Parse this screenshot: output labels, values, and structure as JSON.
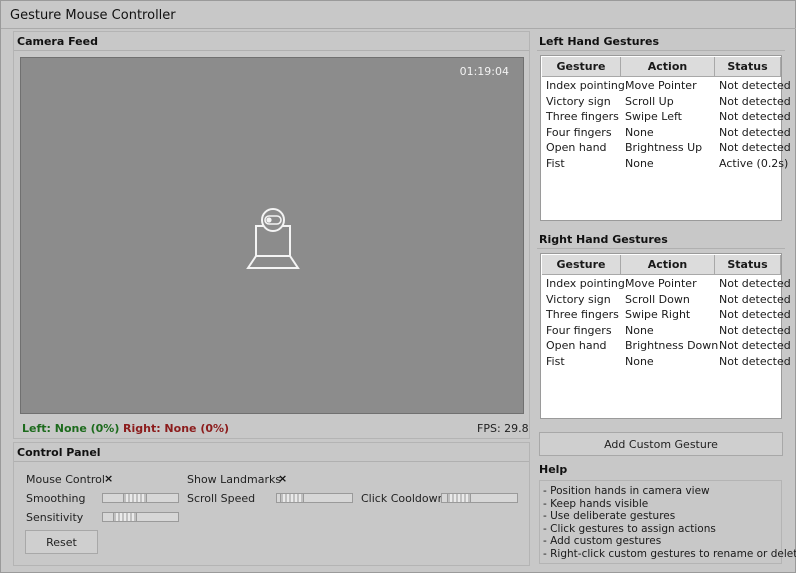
{
  "window": {
    "title": "Gesture Mouse Controller"
  },
  "camera": {
    "label": "Camera Feed",
    "timestamp": "01:19:04",
    "icon": "webcam-icon",
    "left_status": "Left: None (0%)",
    "right_status": "Right: None (0%)",
    "fps": "FPS: 29.8"
  },
  "control_panel": {
    "label": "Control Panel",
    "mouse_control_label": "Mouse Control",
    "mouse_control_mark": "×",
    "show_landmarks_label": "Show Landmarks",
    "show_landmarks_mark": "×",
    "smoothing_label": "Smoothing",
    "smoothing_value": 0.4,
    "scroll_speed_label": "Scroll Speed",
    "scroll_speed_value": 0.05,
    "click_cooldown_label": "Click Cooldown",
    "click_cooldown_value": 0.1,
    "sensitivity_label": "Sensitivity",
    "sensitivity_value": 0.2,
    "reset_label": "Reset"
  },
  "left_gestures": {
    "label": "Left Hand Gestures",
    "columns": [
      "Gesture",
      "Action",
      "Status"
    ],
    "rows": [
      [
        "Index pointing",
        "Move Pointer",
        "Not detected"
      ],
      [
        "Victory sign",
        "Scroll Up",
        "Not detected"
      ],
      [
        "Three fingers",
        "Swipe Left",
        "Not detected"
      ],
      [
        "Four fingers",
        "None",
        "Not detected"
      ],
      [
        "Open hand",
        "Brightness Up",
        "Not detected"
      ],
      [
        "Fist",
        "None",
        "Active (0.2s)"
      ]
    ]
  },
  "right_gestures": {
    "label": "Right Hand Gestures",
    "columns": [
      "Gesture",
      "Action",
      "Status"
    ],
    "rows": [
      [
        "Index pointing",
        "Move Pointer",
        "Not detected"
      ],
      [
        "Victory sign",
        "Scroll Down",
        "Not detected"
      ],
      [
        "Three fingers",
        "Swipe Right",
        "Not detected"
      ],
      [
        "Four fingers",
        "None",
        "Not detected"
      ],
      [
        "Open hand",
        "Brightness Down",
        "Not detected"
      ],
      [
        "Fist",
        "None",
        "Not detected"
      ]
    ]
  },
  "add_custom_label": "Add Custom Gesture",
  "help": {
    "label": "Help",
    "lines": [
      "- Position hands in camera view",
      "- Keep hands visible",
      "- Use deliberate gestures",
      "- Click gestures to assign actions",
      "- Add custom gestures",
      "- Right-click custom gestures to rename or delete"
    ]
  }
}
